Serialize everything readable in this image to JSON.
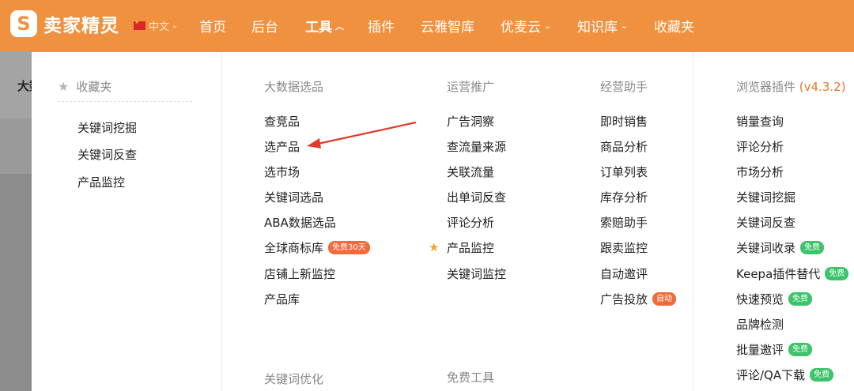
{
  "brand": {
    "logo_glyph": "S",
    "name": "卖家精灵"
  },
  "lang": {
    "label": "中文"
  },
  "nav": {
    "items": [
      {
        "label": "首页"
      },
      {
        "label": "后台"
      },
      {
        "label": "工具"
      },
      {
        "label": "插件"
      },
      {
        "label": "云雅智库"
      },
      {
        "label": "优麦云"
      },
      {
        "label": "知识库"
      },
      {
        "label": "收藏夹"
      }
    ],
    "active": "工具"
  },
  "background": {
    "partial_text": "大数"
  },
  "favorites": {
    "title": "收藏夹",
    "items": [
      "关键词挖掘",
      "关键词反查",
      "产品监控"
    ]
  },
  "columns": {
    "bigdata": {
      "title": "大数据选品",
      "items": [
        "查竞品",
        "选产品",
        "选市场",
        "关键词选品",
        "ABA数据选品",
        "全球商标库",
        "店铺上新监控",
        "产品库"
      ],
      "badge": "免费30天"
    },
    "ops": {
      "title": "运营推广",
      "items": [
        "广告洞察",
        "查流量来源",
        "关联流量",
        "出单词反查",
        "评论分析",
        "产品监控",
        "关键词监控"
      ]
    },
    "assistant": {
      "title": "经营助手",
      "items": [
        "即时销售",
        "商品分析",
        "订单列表",
        "库存分析",
        "索赔助手",
        "跟卖监控",
        "自动邀评",
        "广告投放"
      ],
      "badge": "自动"
    },
    "plugin": {
      "title": "浏览器插件",
      "version": "(v4.3.2)",
      "items": [
        "销量查询",
        "评论分析",
        "市场分析",
        "关键词挖掘",
        "关键词反查",
        "关键词收录",
        "Keepa插件替代",
        "快速预览",
        "品牌检测",
        "批量邀评",
        "评论/QA下载"
      ],
      "badge": "免费"
    },
    "keyword_opt": {
      "title": "关键词优化"
    },
    "free_tools": {
      "title": "免费工具"
    }
  },
  "colors": {
    "brand_orange": "#f0913f",
    "badge_orange": "#f06a3c",
    "badge_green": "#3cc46a",
    "arrow_red": "#e03c28"
  }
}
